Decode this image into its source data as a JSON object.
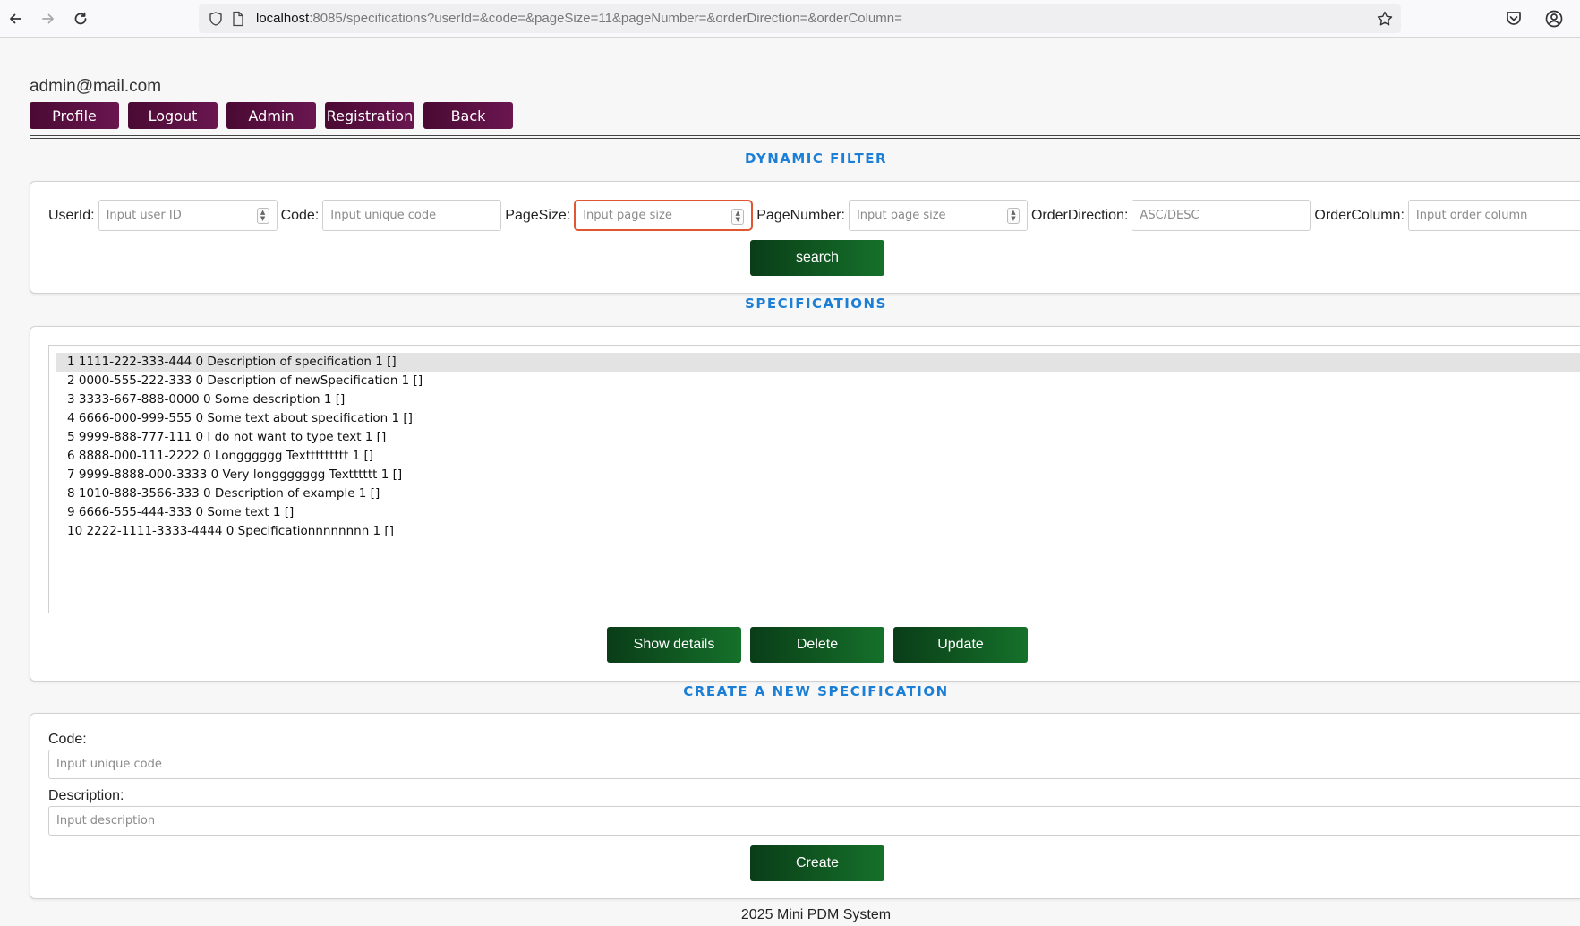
{
  "browser": {
    "url_host": "localhost",
    "url_rest": ":8085/specifications?userId=&code=&pageSize=11&pageNumber=&orderDirection=&orderColumn="
  },
  "user": {
    "email": "admin@mail.com"
  },
  "nav": {
    "profile": "Profile",
    "logout": "Logout",
    "admin": "Admin",
    "registration": "Registration",
    "back": "Back"
  },
  "filter": {
    "title": "DYNAMIC FILTER",
    "userid_label": "UserId:",
    "userid_placeholder": "Input user ID",
    "code_label": "Code:",
    "code_placeholder": "Input unique code",
    "pagesize_label": "PageSize:",
    "pagesize_placeholder": "Input page size",
    "pagenumber_label": "PageNumber:",
    "pagenumber_placeholder": "Input page size",
    "orderdirection_label": "OrderDirection:",
    "orderdirection_placeholder": "ASC/DESC",
    "ordercolumn_label": "OrderColumn:",
    "ordercolumn_placeholder": "Input order column",
    "search_label": "search"
  },
  "specifications": {
    "title": "SPECIFICATIONS",
    "items": [
      "1 1111-222-333-444 0 Description of specification 1 []",
      "2 0000-555-222-333 0 Description of newSpecification 1 []",
      "3 3333-667-888-0000 0 Some description 1 []",
      "4 6666-000-999-555 0 Some text about specification 1 []",
      "5 9999-888-777-111 0 I do not want to type text 1 []",
      "6 8888-000-111-2222 0 Longggggg Texttttttttt 1 []",
      "7 9999-8888-000-3333 0 Very longgggggg Textttttt 1 []",
      "8 1010-888-3566-333 0 Description of example 1 []",
      "9 6666-555-444-333 0 Some text 1 []",
      "10 2222-1111-3333-4444 0 Specificationnnnnnnn 1 []"
    ],
    "show_details_label": "Show details",
    "delete_label": "Delete",
    "update_label": "Update"
  },
  "create": {
    "title": "CREATE A NEW SPECIFICATION",
    "code_label": "Code:",
    "code_placeholder": "Input unique code",
    "description_label": "Description:",
    "description_placeholder": "Input description",
    "create_label": "Create"
  },
  "footer": {
    "text": "2025 Mini PDM System"
  },
  "colors": {
    "nav_button": "#5a0f40",
    "green_button": "#0f5a22",
    "section_title": "#1c7fd6",
    "focus_border": "#e0562f"
  }
}
